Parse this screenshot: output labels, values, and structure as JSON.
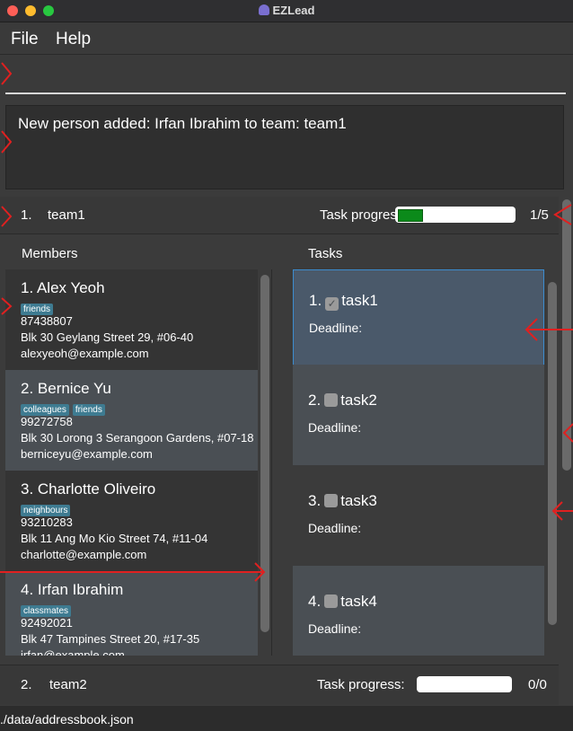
{
  "window": {
    "title": "EZLead"
  },
  "menu": [
    "File",
    "Help"
  ],
  "command": {
    "value": "",
    "placeholder": ""
  },
  "result": {
    "message": "New person added: Irfan Ibrahim to team: team1"
  },
  "teams": [
    {
      "index": "1.",
      "name": "team1",
      "progress_label": "Task progress:",
      "progress_count": "1/5",
      "progress_fraction": 0.2,
      "members_label": "Members",
      "tasks_label": "Tasks",
      "members": [
        {
          "name": "1.  Alex Yeoh",
          "tags": [
            "friends"
          ],
          "phone": "87438807",
          "address": "Blk 30 Geylang Street 29, #06-40",
          "email": "alexyeoh@example.com"
        },
        {
          "name": "2.  Bernice Yu",
          "tags": [
            "colleagues",
            "friends"
          ],
          "phone": "99272758",
          "address": "Blk 30 Lorong 3 Serangoon Gardens, #07-18",
          "email": "berniceyu@example.com"
        },
        {
          "name": "3.  Charlotte Oliveiro",
          "tags": [
            "neighbours"
          ],
          "phone": "93210283",
          "address": "Blk 11 Ang Mo Kio Street 74, #11-04",
          "email": "charlotte@example.com"
        },
        {
          "name": "4.  Irfan Ibrahim",
          "tags": [
            "classmates"
          ],
          "phone": "92492021",
          "address": "Blk 47 Tampines Street 20, #17-35",
          "email": "irfan@example.com"
        }
      ],
      "tasks": [
        {
          "index": "1.",
          "name": "task1",
          "done": true,
          "deadline_label": "Deadline:"
        },
        {
          "index": "2.",
          "name": "task2",
          "done": false,
          "deadline_label": "Deadline:"
        },
        {
          "index": "3.",
          "name": "task3",
          "done": false,
          "deadline_label": "Deadline:"
        },
        {
          "index": "4.",
          "name": "task4",
          "done": false,
          "deadline_label": "Deadline:"
        }
      ]
    },
    {
      "index": "2.",
      "name": "team2",
      "progress_label": "Task progress:",
      "progress_count": "0/0",
      "progress_fraction": 0
    }
  ],
  "status": {
    "path": "./data/addressbook.json"
  },
  "colors": {
    "annotation": "#e02020",
    "selected_border": "#3c8ccf",
    "progress_fill": "#0b8a1a",
    "tag": "#3e7b91"
  },
  "icons": [
    "close-icon",
    "minimize-icon",
    "zoom-icon",
    "app-icon",
    "checkbox-icon"
  ]
}
